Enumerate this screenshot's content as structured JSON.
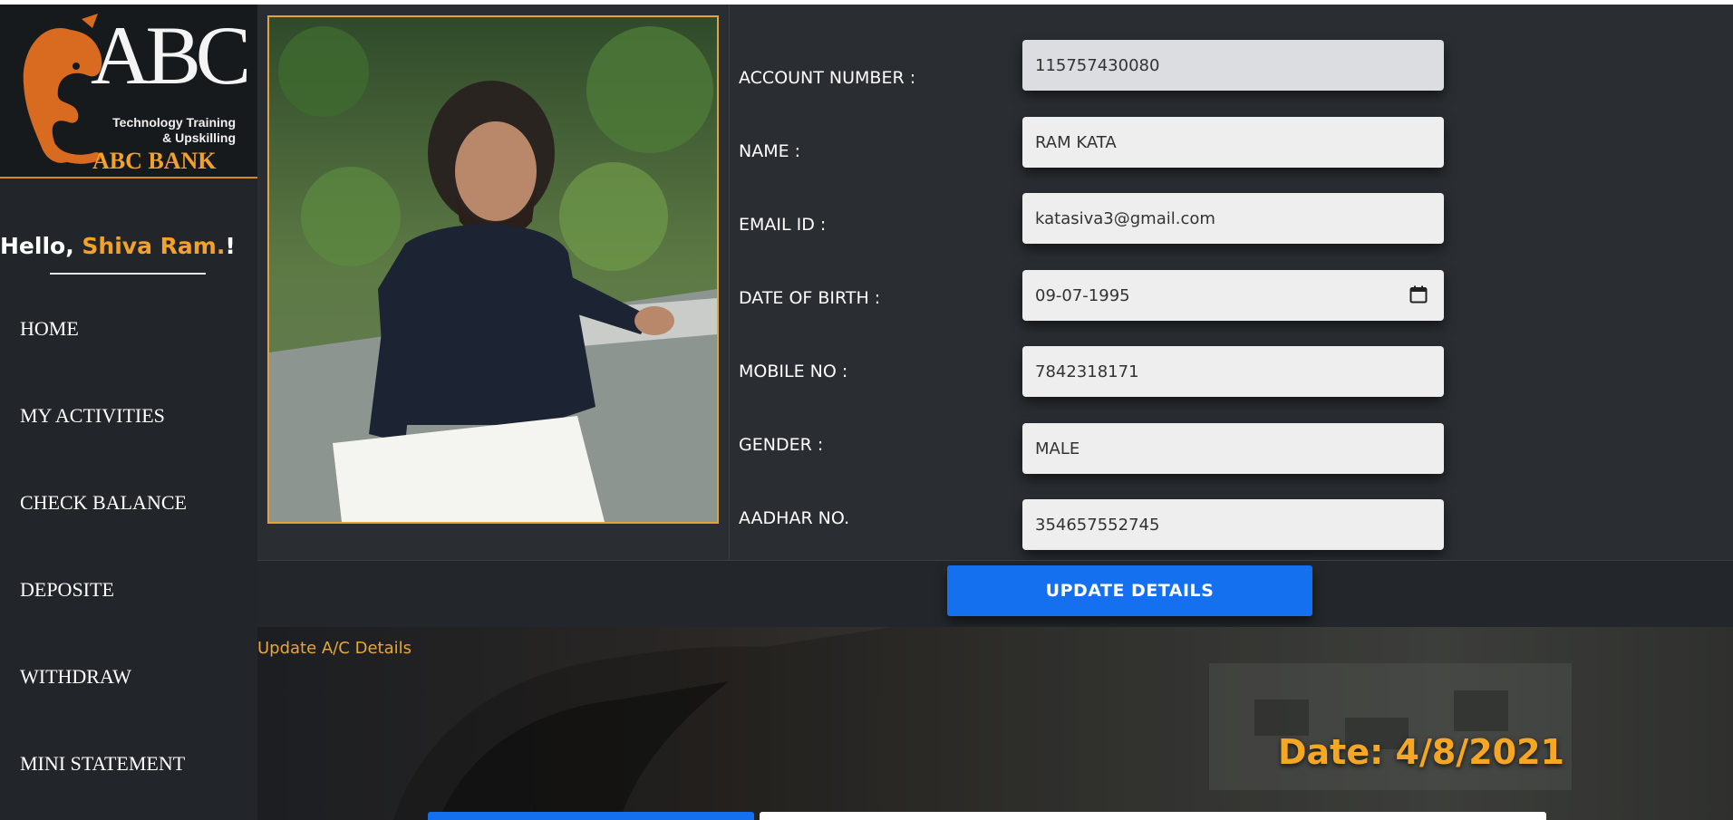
{
  "brand": {
    "logo_text": "ABC",
    "tagline_1": "Technology Training",
    "tagline_2": "& Upskilling",
    "bank_name": "ABC BANK",
    "accent_color": "#f2a12b"
  },
  "greeting": {
    "prefix": "Hello,",
    "username": "Shiva Ram.",
    "suffix": "!"
  },
  "nav": {
    "items": [
      {
        "label": "HOME"
      },
      {
        "label": "MY ACTIVITIES"
      },
      {
        "label": "CHECK BALANCE"
      },
      {
        "label": "DEPOSITE"
      },
      {
        "label": "WITHDRAW"
      },
      {
        "label": "MINI STATEMENT"
      }
    ]
  },
  "form": {
    "fields": [
      {
        "label": "ACCOUNT NUMBER :",
        "value": "115757430080"
      },
      {
        "label": "NAME :",
        "value": "RAM KATA"
      },
      {
        "label": "EMAIL ID :",
        "value": "katasiva3@gmail.com"
      },
      {
        "label": "DATE OF BIRTH :",
        "value": "09-07-1995"
      },
      {
        "label": "MOBILE NO :",
        "value": "7842318171"
      },
      {
        "label": "GENDER :",
        "value": "MALE"
      },
      {
        "label": "AADHAR NO.",
        "value": "354657552745"
      }
    ],
    "submit_label": "UPDATE DETAILS"
  },
  "footer": {
    "link_label": "Update A/C Details",
    "date_text": "Date: 4/8/2021"
  },
  "colors": {
    "primary_button": "#1570ef",
    "date_color": "#f5a623"
  },
  "icons": [
    "calendar-icon",
    "elephant-logo-icon"
  ]
}
